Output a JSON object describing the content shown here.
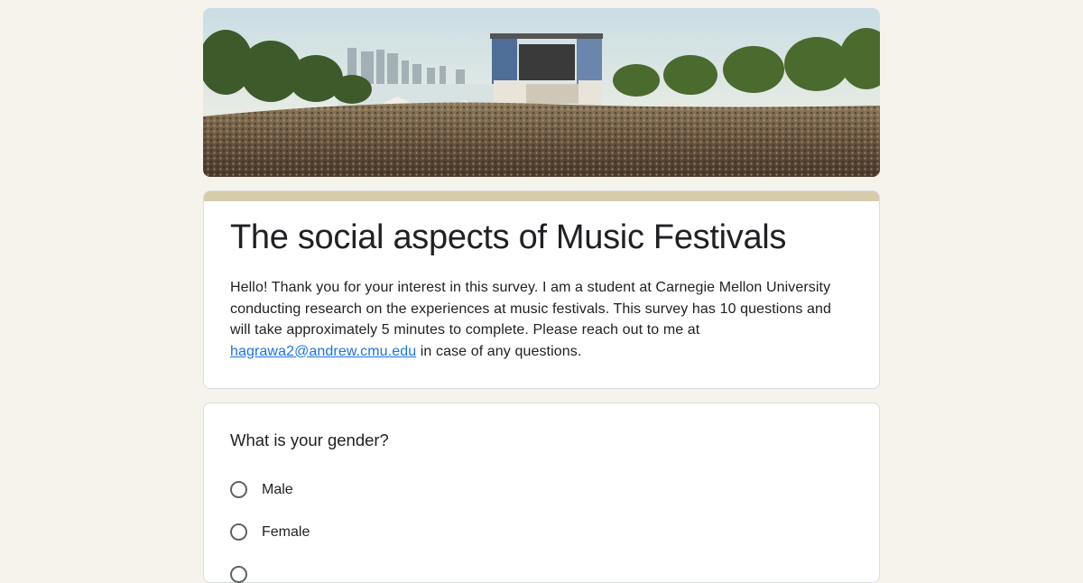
{
  "header": {
    "image": "music-festival-crowd-banner"
  },
  "form": {
    "title": "The social aspects of Music Festivals",
    "description_before_link": "Hello! Thank you for your interest in this survey. I am a student at Carnegie Mellon University conducting research on the experiences at music festivals. This survey has 10 questions and will take approximately 5 minutes to complete. Please reach out to me at ",
    "email_link": "hagrawa2@andrew.cmu.edu",
    "description_after_link": " in case of any questions."
  },
  "question": {
    "title": "What is your gender?",
    "options": [
      {
        "label": "Male"
      },
      {
        "label": "Female"
      },
      {
        "label": ""
      }
    ]
  },
  "colors": {
    "background": "#f6f3ec",
    "accent": "#d6ccac",
    "link": "#1a73e8",
    "text": "#202124"
  }
}
